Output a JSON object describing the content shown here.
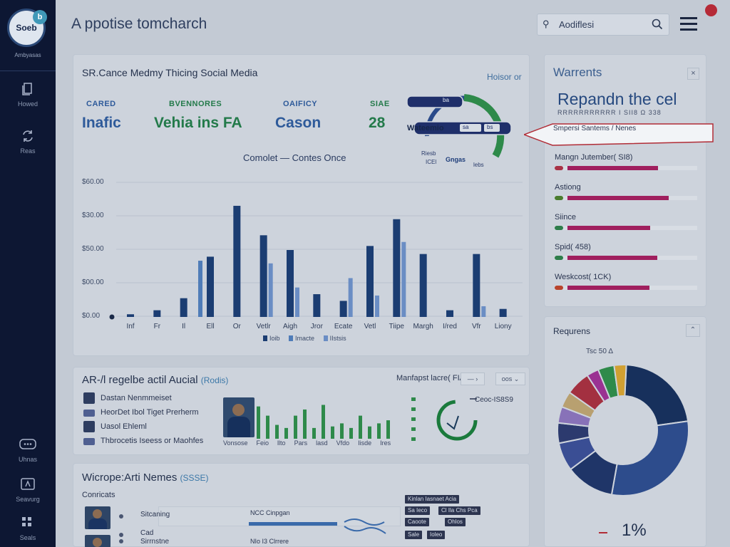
{
  "app": {
    "title": "A ppotise tomcharch",
    "logo_text": "Soeb",
    "logo_badge": "b",
    "logo_caption": "Ambyasas"
  },
  "sidebar": {
    "items": [
      {
        "label": "Howed",
        "icon": "document-icon"
      },
      {
        "label": "Reas",
        "icon": "refresh-icon"
      },
      {
        "label": "Uhnas",
        "icon": "chat-icon"
      },
      {
        "label": "Seavurg",
        "icon": "tag-icon"
      },
      {
        "label": "Seals",
        "icon": "grid-icon"
      }
    ]
  },
  "search": {
    "value": "Aodiflesi",
    "placeholder": "Aodiflesi"
  },
  "main": {
    "title": "SR.Cance Medmy Thicing Social Media",
    "link": "Hoisor or",
    "kpis": [
      {
        "label": "CARED",
        "value": "Inafic",
        "color": "#2e5a9a"
      },
      {
        "label": "BVENNORES",
        "value": "Vehia ins FA",
        "color": "#237a4a"
      },
      {
        "label": "OAIFICY",
        "value": "Cason",
        "color": "#2e5a9a"
      },
      {
        "label": "SIAE",
        "value": "28",
        "color": "#237a4a"
      }
    ],
    "gauge": {
      "label": "Wateemio",
      "chip1": "ba",
      "chip2": "sa",
      "chip3": "Gisaa",
      "chip4": "bs",
      "bottom_a": "Riesb",
      "bottom_b": "ICEl",
      "bottom_c": "Gngas",
      "bottom_d": "lebs"
    },
    "chart_title": "Comolet — Contes Once"
  },
  "chart_data": {
    "type": "bar",
    "title": "Comolet — Contes Once",
    "ytick_labels": [
      "$60.00",
      "$30.00",
      "$50.00",
      "$00.00",
      "$0.00"
    ],
    "categories": [
      "Inf",
      "Fr",
      "Il",
      "Ell",
      "Or",
      "Vetlr",
      "Aigh",
      "Jror",
      "Ecate",
      "Vetl",
      "Tiipe",
      "Margh",
      "I/red",
      "Vfr",
      "Liony"
    ],
    "ylim": [
      0,
      100
    ],
    "series": [
      {
        "name": "Ioib",
        "color": "#1b3d72",
        "values": [
          2,
          5,
          14,
          45,
          83,
          61,
          50,
          17,
          12,
          53,
          73,
          47,
          5,
          47,
          6
        ]
      },
      {
        "name": "Imacte",
        "color": "#4f7cb8",
        "values": [
          0,
          0,
          0,
          42,
          0,
          0,
          0,
          0,
          0,
          0,
          0,
          0,
          0,
          0,
          0
        ]
      },
      {
        "name": "IIstsis",
        "color": "#6a8dc4",
        "values": [
          0,
          0,
          0,
          0,
          0,
          40,
          22,
          0,
          29,
          16,
          56,
          0,
          0,
          8,
          0
        ]
      }
    ],
    "legend": "bottom",
    "grid": true
  },
  "warrents": {
    "title": "Warrents",
    "close": "×",
    "big": "Repandn the cel",
    "sub": "RRRRRRRRRRR I SII8 Ω 338",
    "callout": "Smpersi  Santems / Nenes",
    "bars": [
      {
        "label": "Mangn Jutember( SI8)",
        "value": 0.7,
        "dot": "#a83246"
      },
      {
        "label": "Astiong",
        "value": 0.78,
        "dot": "#4a7c2e"
      },
      {
        "label": "Siince",
        "value": 0.64,
        "dot": "#2e7d4a"
      },
      {
        "label": "Spid( 458)",
        "value": 0.69,
        "dot": "#2e7d4a"
      },
      {
        "label": "Weskcost( 1CK)",
        "value": 0.63,
        "dot": "#b8442c"
      }
    ]
  },
  "mid": {
    "title": "AR-/l regelbe actil Aucial",
    "tag": "(Rodis)",
    "right_label": "Manfapst lacre( FIA",
    "btn1": "— ›",
    "btn2": "oos ⌄",
    "people": [
      "Dastan Nenmmeiset",
      "HeorDet Ibol Tiget Prerherm",
      "Uasol Ehleml",
      "Thbrocetis Iseess or Maohfes"
    ],
    "captions": [
      "Vonsose",
      "Feio",
      "llto",
      "Pars",
      "lasd",
      "Vfdo",
      "Iisde",
      "Ires"
    ],
    "mini_bars": [
      42,
      30,
      18,
      14,
      30,
      38,
      14,
      44,
      16,
      20,
      14,
      30,
      16,
      20,
      24
    ],
    "gauge_label": "Ceoc-IS8S9"
  },
  "requests": {
    "title": "Requrens",
    "btn": "⌃",
    "badge": "Tsc 50 ∆",
    "pct": "1%",
    "pie": [
      {
        "value": 22,
        "color": "#17305c"
      },
      {
        "value": 30,
        "color": "#2d4c8c"
      },
      {
        "value": 12,
        "color": "#1f3568"
      },
      {
        "value": 7,
        "color": "#3a4e94"
      },
      {
        "value": 5,
        "color": "#2c3a6e"
      },
      {
        "value": 4,
        "color": "#8872b8"
      },
      {
        "value": 4,
        "color": "#b8a070"
      },
      {
        "value": 6,
        "color": "#a33040"
      },
      {
        "value": 3,
        "color": "#9a3292"
      },
      {
        "value": 4,
        "color": "#2f8a4a"
      },
      {
        "value": 3,
        "color": "#d1a032"
      }
    ]
  },
  "news": {
    "title": "Wicrope:Arti Nemes",
    "tag": "(SSSE)",
    "sub": "Conricats",
    "rows": [
      {
        "text": "Sitcaning",
        "detail": "NCC Cinpgan"
      },
      {
        "text": "Cad",
        "detail": ""
      },
      {
        "text": "Sirrnstne",
        "detail": "NIo I3 Clrrere"
      }
    ],
    "tags": [
      "Kinlan Iasnaet Acia",
      "Sa Ieco",
      "Cl Ila Chs Pca",
      "Caoote",
      "Ohlos",
      "Sale",
      "Ioleo"
    ]
  }
}
